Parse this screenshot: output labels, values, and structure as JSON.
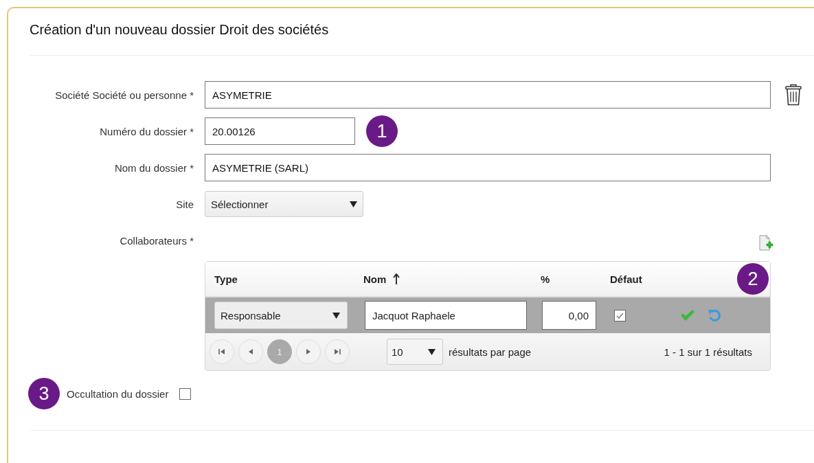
{
  "title": "Création d'un nouveau dossier Droit des sociétés",
  "callouts": [
    "1",
    "2",
    "3"
  ],
  "fields": [
    {
      "kind": "wide",
      "label": "Société Société ou personne *",
      "value": "ASYMETRIE",
      "deletable": true
    },
    {
      "kind": "short",
      "label": "Numéro du dossier *",
      "value": "20.00126",
      "deletable": false
    },
    {
      "kind": "wide",
      "label": "Nom du dossier *",
      "value": "ASYMETRIE (SARL)",
      "deletable": false
    },
    {
      "kind": "select",
      "label": "Site",
      "value": "Sélectionner",
      "deletable": false
    }
  ],
  "collaborators": {
    "label": "Collaborateurs *",
    "columns": [
      {
        "label": "Type",
        "sorted": false
      },
      {
        "label": "Nom",
        "sorted": true
      },
      {
        "label": "%",
        "sorted": false
      },
      {
        "label": "Défaut",
        "sorted": false
      }
    ],
    "rows": [
      {
        "type": "Responsable",
        "name": "Jacquot Raphaele",
        "percent": "0,00",
        "default": true
      }
    ],
    "pages": [
      {
        "label": "1",
        "selected": true
      }
    ],
    "page_size": "10",
    "page_size_label": "résultats par page",
    "summary": "1 - 1 sur 1 résultats"
  },
  "occultation": {
    "label": "Occultation du dossier",
    "checked": false
  }
}
